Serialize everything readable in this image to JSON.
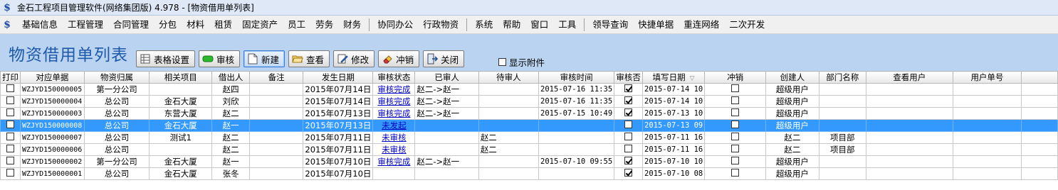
{
  "window": {
    "title": "金石工程项目管理软件(网络集团版) 4.978 - [物资借用单列表]"
  },
  "menu": [
    {
      "label": "基础信息"
    },
    {
      "label": "工程管理"
    },
    {
      "label": "合同管理"
    },
    {
      "label": "分包"
    },
    {
      "label": "材料"
    },
    {
      "label": "租赁"
    },
    {
      "label": "固定资产"
    },
    {
      "label": "员工"
    },
    {
      "label": "劳务"
    },
    {
      "label": "财务"
    },
    {
      "label": "协同办公"
    },
    {
      "label": "行政物资"
    },
    {
      "label": "系统"
    },
    {
      "label": "帮助"
    },
    {
      "label": "窗口"
    },
    {
      "label": "工具"
    },
    {
      "label": "领导查询"
    },
    {
      "label": "快捷单据"
    },
    {
      "label": "重连网络"
    },
    {
      "label": "二次开发"
    }
  ],
  "page_title": "物资借用单列表",
  "toolbar": {
    "settings": "表格设置",
    "audit": "审核",
    "new": "新建",
    "view": "查看",
    "edit": "修改",
    "offset": "冲销",
    "close": "关闭"
  },
  "show_attachments": "显示附件",
  "columns": [
    "打印",
    "对应单据",
    "物资归属",
    "相关项目",
    "借出人",
    "备注",
    "发生日期",
    "审核状态",
    "已审人",
    "待审人",
    "审核时间",
    "审核否",
    "填写日期",
    "冲销",
    "创建人",
    "部门名称",
    "查看用户",
    "用户单号"
  ],
  "rows": [
    {
      "doc": "WZJYD150000005",
      "owner": "第一分公司",
      "project": "",
      "lender": "赵四",
      "note": "",
      "date": "2015年07月14日",
      "status": "审核完成",
      "approved": "赵二->赵一",
      "pending": "",
      "audit_time": "2015-07-16 11:35",
      "audited": true,
      "fill_date": "2015-07-14 10",
      "offset": false,
      "creator": "超级用户",
      "dept": "",
      "viewer": "",
      "user_no": ""
    },
    {
      "doc": "WZJYD150000004",
      "owner": "总公司",
      "project": "金石大厦",
      "lender": "刘欣",
      "note": "",
      "date": "2015年07月14日",
      "status": "审核完成",
      "approved": "赵二->赵一",
      "pending": "",
      "audit_time": "2015-07-16 11:35",
      "audited": true,
      "fill_date": "2015-07-14 10",
      "offset": false,
      "creator": "超级用户",
      "dept": "",
      "viewer": "",
      "user_no": ""
    },
    {
      "doc": "WZJYD150000003",
      "owner": "总公司",
      "project": "东营大厦",
      "lender": "赵二",
      "note": "",
      "date": "2015年07月13日",
      "status": "审核完成",
      "approved": "赵二->赵一",
      "pending": "",
      "audit_time": "2015-07-15 10:49",
      "audited": true,
      "fill_date": "2015-07-13 10",
      "offset": false,
      "creator": "超级用户",
      "dept": "",
      "viewer": "",
      "user_no": ""
    },
    {
      "doc": "WZJYD150000008",
      "owner": "总公司",
      "project": "金石大厦",
      "lender": "赵一",
      "note": "",
      "date": "2015年07月13日",
      "status": "未发起",
      "approved": "",
      "pending": "",
      "audit_time": "",
      "audited": false,
      "fill_date": "2015-07-13 09",
      "offset": false,
      "creator": "超级用户",
      "dept": "",
      "viewer": "",
      "user_no": "",
      "selected": true
    },
    {
      "doc": "WZJYD150000007",
      "owner": "总公司",
      "project": "测试1",
      "lender": "赵二",
      "note": "",
      "date": "2015年07月11日",
      "status": "未审核",
      "approved": "",
      "pending": "赵二",
      "audit_time": "",
      "audited": false,
      "fill_date": "2015-07-11 16",
      "offset": false,
      "creator": "赵二",
      "dept": "项目部",
      "viewer": "",
      "user_no": ""
    },
    {
      "doc": "WZJYD150000006",
      "owner": "总公司",
      "project": "",
      "lender": "赵二",
      "note": "",
      "date": "2015年07月11日",
      "status": "未审核",
      "approved": "",
      "pending": "赵二",
      "audit_time": "",
      "audited": false,
      "fill_date": "2015-07-11 16",
      "offset": false,
      "creator": "赵二",
      "dept": "项目部",
      "viewer": "",
      "user_no": ""
    },
    {
      "doc": "WZJYD150000002",
      "owner": "第一分公司",
      "project": "金石大厦",
      "lender": "赵一",
      "note": "",
      "date": "2015年07月10日",
      "status": "审核完成",
      "approved": "赵二->赵一",
      "pending": "",
      "audit_time": "2015-07-10 09:55",
      "audited": true,
      "fill_date": "2015-07-10 10",
      "offset": false,
      "creator": "超级用户",
      "dept": "",
      "viewer": "",
      "user_no": ""
    },
    {
      "doc": "WZJYD150000001",
      "owner": "总公司",
      "project": "金石大厦",
      "lender": "张冬",
      "note": "",
      "date": "2015年07月10日",
      "status": "",
      "approved": "",
      "pending": "",
      "audit_time": "",
      "audited": true,
      "fill_date": "2015-07-10 08",
      "offset": false,
      "creator": "超级用户",
      "dept": "",
      "viewer": "",
      "user_no": ""
    }
  ]
}
